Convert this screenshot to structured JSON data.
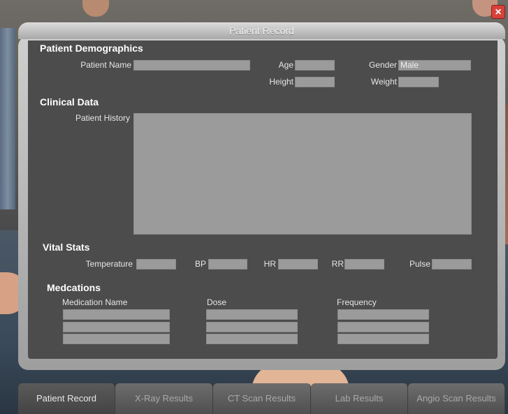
{
  "window": {
    "title": "Patient Record",
    "close_symbol": "×"
  },
  "demographics": {
    "heading": "Patient Demographics",
    "patient_name_label": "Patient Name",
    "patient_name_value": "",
    "age_label": "Age",
    "age_value": "",
    "gender_label": "Gender",
    "gender_value": "Male",
    "height_label": "Height",
    "height_value": "",
    "weight_label": "Weight",
    "weight_value": ""
  },
  "clinical": {
    "heading": "Clinical Data",
    "history_label": "Patient History",
    "history_value": ""
  },
  "vitals": {
    "heading": "Vital Stats",
    "temperature_label": "Temperature",
    "bp_label": "BP",
    "hr_label": "HR",
    "rr_label": "RR",
    "pulse_label": "Pulse"
  },
  "medications": {
    "heading": "Medcations",
    "col_name": "Medication Name",
    "col_dose": "Dose",
    "col_frequency": "Frequency"
  },
  "tabs": [
    {
      "label": "Patient Record",
      "active": true
    },
    {
      "label": "X-Ray Results",
      "active": false
    },
    {
      "label": "CT Scan Results",
      "active": false
    },
    {
      "label": "Lab Results",
      "active": false
    },
    {
      "label": "Angio Scan Results",
      "active": false
    }
  ],
  "colors": {
    "close_button": "#d8403a",
    "panel_background": "#4c4c4c",
    "field_background": "#9b9b9b"
  }
}
